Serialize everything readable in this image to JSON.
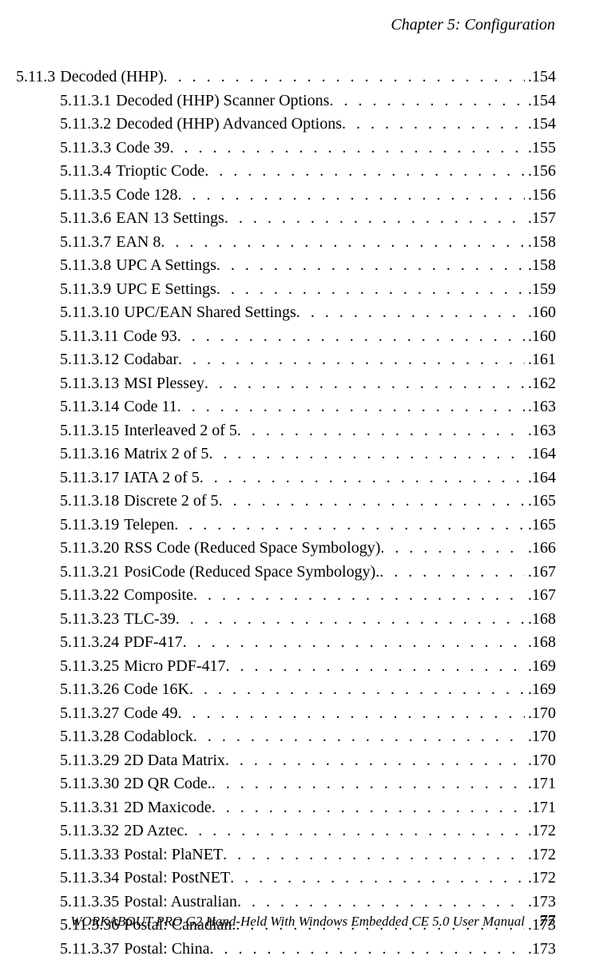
{
  "header": {
    "chapter": "Chapter  5:  Configuration"
  },
  "toc": [
    {
      "level": 1,
      "num": "5.11.3",
      "title": "Decoded (HHP)",
      "page": "154"
    },
    {
      "level": 2,
      "num": "5.11.3.1",
      "title": "Decoded (HHP) Scanner Options",
      "page": "154"
    },
    {
      "level": 2,
      "num": "5.11.3.2",
      "title": "Decoded (HHP) Advanced Options",
      "page": "154"
    },
    {
      "level": 2,
      "num": "5.11.3.3",
      "title": "Code 39",
      "page": "155"
    },
    {
      "level": 2,
      "num": "5.11.3.4",
      "title": "Trioptic Code",
      "page": "156"
    },
    {
      "level": 2,
      "num": "5.11.3.5",
      "title": "Code 128",
      "page": "156"
    },
    {
      "level": 2,
      "num": "5.11.3.6",
      "title": "EAN 13 Settings",
      "page": "157"
    },
    {
      "level": 2,
      "num": "5.11.3.7",
      "title": "EAN 8",
      "page": "158"
    },
    {
      "level": 2,
      "num": "5.11.3.8",
      "title": "UPC A Settings",
      "page": "158"
    },
    {
      "level": 2,
      "num": "5.11.3.9",
      "title": "UPC E Settings",
      "page": "159"
    },
    {
      "level": 2,
      "num": "5.11.3.10",
      "title": "UPC/EAN Shared Settings",
      "page": "160"
    },
    {
      "level": 2,
      "num": "5.11.3.11",
      "title": "Code 93",
      "page": "160"
    },
    {
      "level": 2,
      "num": "5.11.3.12",
      "title": "Codabar",
      "page": "161"
    },
    {
      "level": 2,
      "num": "5.11.3.13",
      "title": "MSI Plessey",
      "page": "162"
    },
    {
      "level": 2,
      "num": "5.11.3.14",
      "title": "Code 11",
      "page": "163"
    },
    {
      "level": 2,
      "num": "5.11.3.15",
      "title": "Interleaved 2 of 5",
      "page": "163"
    },
    {
      "level": 2,
      "num": "5.11.3.16",
      "title": "Matrix 2 of 5",
      "page": "164"
    },
    {
      "level": 2,
      "num": "5.11.3.17",
      "title": "IATA 2 of 5",
      "page": "164"
    },
    {
      "level": 2,
      "num": "5.11.3.18",
      "title": "Discrete 2 of 5",
      "page": "165"
    },
    {
      "level": 2,
      "num": "5.11.3.19",
      "title": "Telepen",
      "page": "165"
    },
    {
      "level": 2,
      "num": "5.11.3.20",
      "title": "RSS Code (Reduced Space Symbology)",
      "page": "166"
    },
    {
      "level": 2,
      "num": "5.11.3.21",
      "title": "PosiCode (Reduced Space Symbology).",
      "page": "167"
    },
    {
      "level": 2,
      "num": "5.11.3.22",
      "title": "Composite",
      "page": "167"
    },
    {
      "level": 2,
      "num": "5.11.3.23",
      "title": "TLC-39",
      "page": "168"
    },
    {
      "level": 2,
      "num": "5.11.3.24",
      "title": "PDF-417",
      "page": "168"
    },
    {
      "level": 2,
      "num": "5.11.3.25",
      "title": "Micro PDF-417",
      "page": "169"
    },
    {
      "level": 2,
      "num": "5.11.3.26",
      "title": "Code 16K",
      "page": "169"
    },
    {
      "level": 2,
      "num": "5.11.3.27",
      "title": "Code 49",
      "page": "170"
    },
    {
      "level": 2,
      "num": "5.11.3.28",
      "title": "Codablock",
      "page": "170"
    },
    {
      "level": 2,
      "num": "5.11.3.29",
      "title": "2D Data Matrix",
      "page": "170"
    },
    {
      "level": 2,
      "num": "5.11.3.30",
      "title": "2D QR Code.",
      "page": "171"
    },
    {
      "level": 2,
      "num": "5.11.3.31",
      "title": "2D Maxicode",
      "page": "171"
    },
    {
      "level": 2,
      "num": "5.11.3.32",
      "title": "2D Aztec",
      "page": "172"
    },
    {
      "level": 2,
      "num": "5.11.3.33",
      "title": "Postal: PlaNET",
      "page": "172"
    },
    {
      "level": 2,
      "num": "5.11.3.34",
      "title": "Postal: PostNET",
      "page": "172"
    },
    {
      "level": 2,
      "num": "5.11.3.35",
      "title": "Postal: Australian",
      "page": "173"
    },
    {
      "level": 2,
      "num": "5.11.3.36",
      "title": "Postal: Canadian.",
      "page": "173"
    },
    {
      "level": 2,
      "num": "5.11.3.37",
      "title": "Postal: China",
      "page": "173"
    }
  ],
  "footer": {
    "text": "WORKABOUT PRO G2 Hand-Held With Windows Embedded CE 5.0 User Manual",
    "page": "77"
  }
}
